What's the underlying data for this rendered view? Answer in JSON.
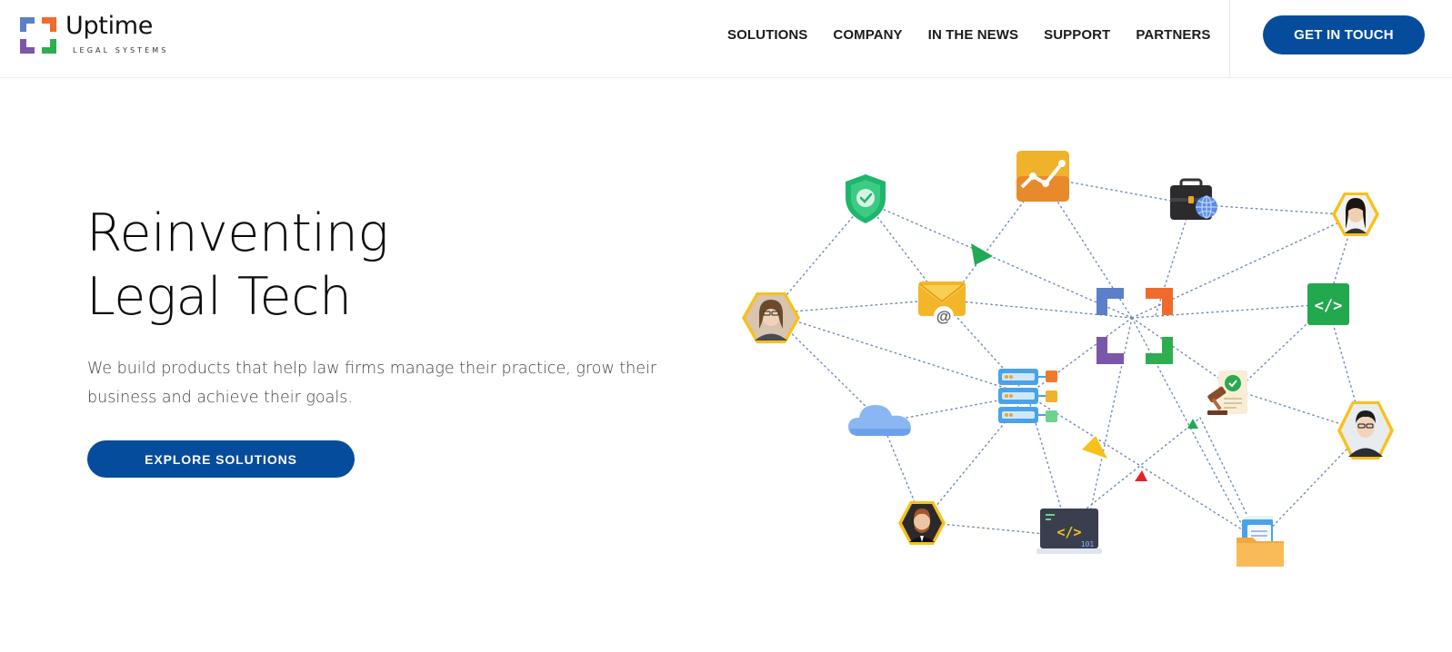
{
  "brand": {
    "name": "Uptime",
    "tagline": "LEGAL SYSTEMS",
    "colors": {
      "blue": "#5b7fc8",
      "orange": "#f06a2a",
      "purple": "#7a57a8",
      "green": "#2dae50"
    }
  },
  "nav": {
    "items": [
      {
        "label": "SOLUTIONS"
      },
      {
        "label": "COMPANY"
      },
      {
        "label": "IN THE NEWS"
      },
      {
        "label": "SUPPORT"
      },
      {
        "label": "PARTNERS"
      }
    ],
    "cta_label": "GET IN TOUCH"
  },
  "hero": {
    "title_line1": "Reinventing",
    "title_line2": "Legal Tech",
    "description": "We build products that help law firms manage their practice, grow their business and achieve their goals.",
    "cta_label": "EXPLORE SOLUTIONS"
  },
  "code_badge": "101",
  "colors": {
    "primary": "#064c9c",
    "hex_border": "#f7c11c",
    "dot_line": "#6f8ab8"
  }
}
